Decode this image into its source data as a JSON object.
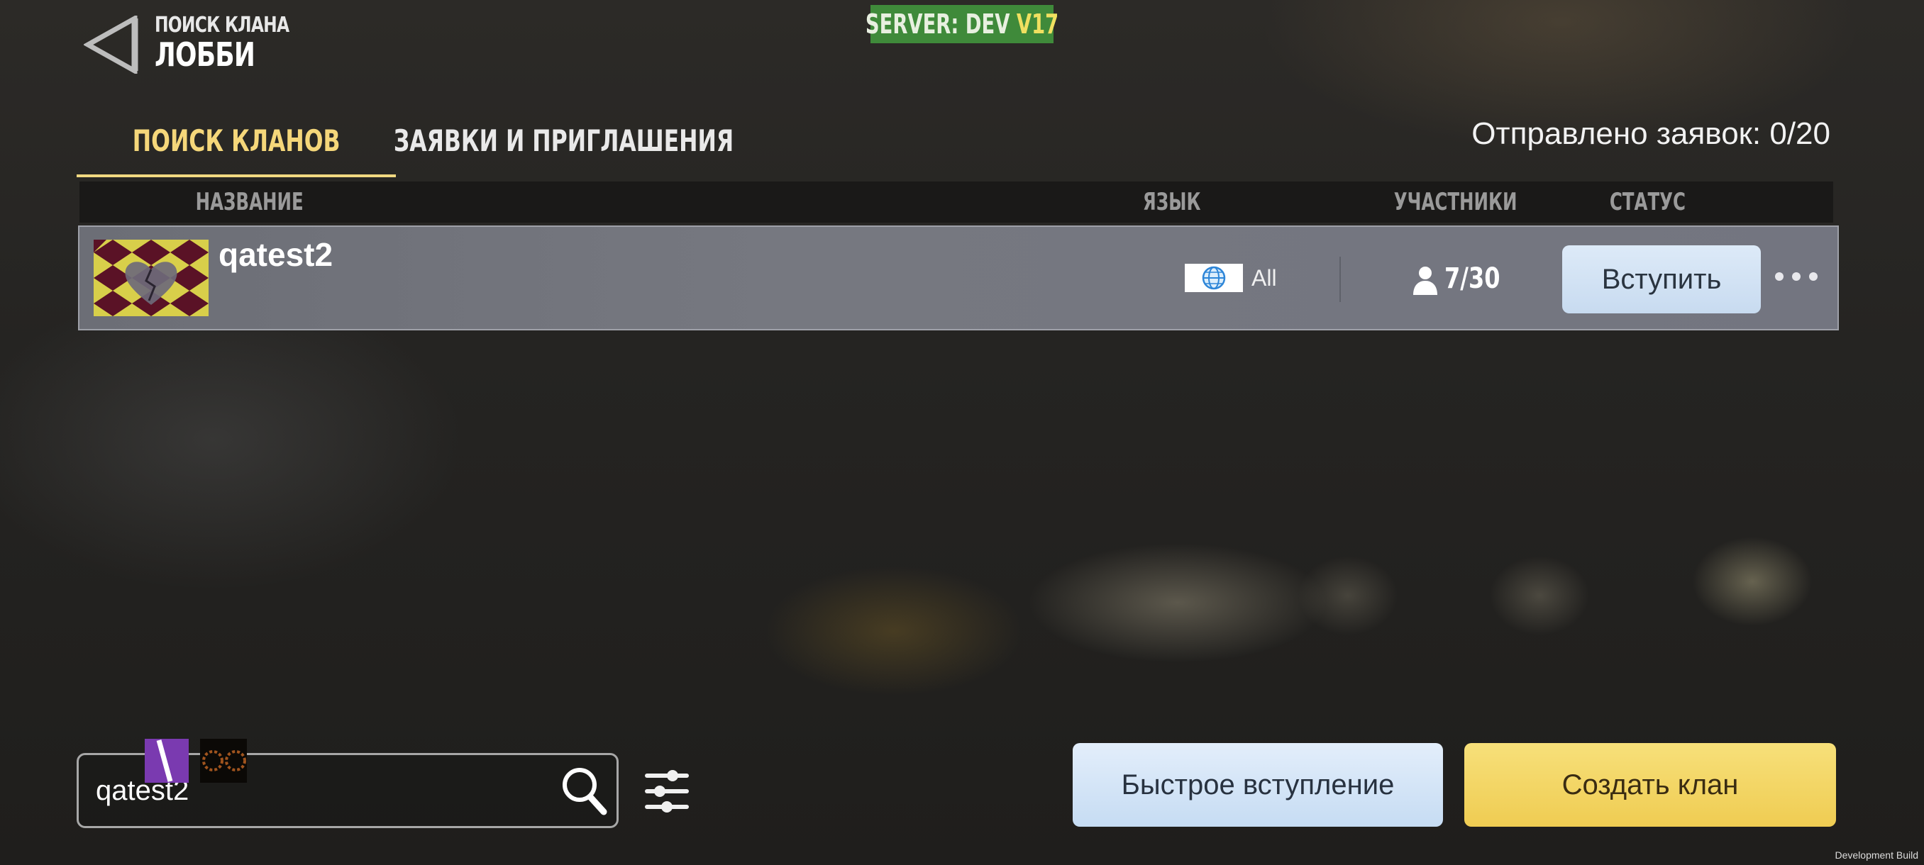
{
  "header": {
    "breadcrumb_sub": "ПОИСК КЛАНА",
    "breadcrumb_title": "ЛОББИ",
    "server_label": "SERVER: DEV",
    "server_version": "V17",
    "server_color": "#3f8a3a"
  },
  "tabs": [
    {
      "label": "ПОИСК КЛАНОВ",
      "active": true
    },
    {
      "label": "ЗАЯВКИ И ПРИГЛАШЕНИЯ",
      "active": false
    }
  ],
  "requests_sent": "Отправлено заявок: 0/20",
  "table": {
    "columns": [
      "НАЗВАНИЕ",
      "ЯЗЫК",
      "УЧАСТНИКИ",
      "СТАТУС"
    ],
    "rows": [
      {
        "name": "qatest2",
        "language": "All",
        "members": "7/30",
        "action": "Вступить",
        "emblem": "heart-emblem-icon"
      }
    ]
  },
  "search": {
    "value": "qatest2"
  },
  "buttons": {
    "quick_join": "Быстрое вступление",
    "create_clan": "Создать клан"
  },
  "footer": {
    "build": "Development Build"
  },
  "colors": {
    "accent": "#f5d77a",
    "join_button": "#ddeaf8",
    "create_button": "#f4d76a"
  }
}
